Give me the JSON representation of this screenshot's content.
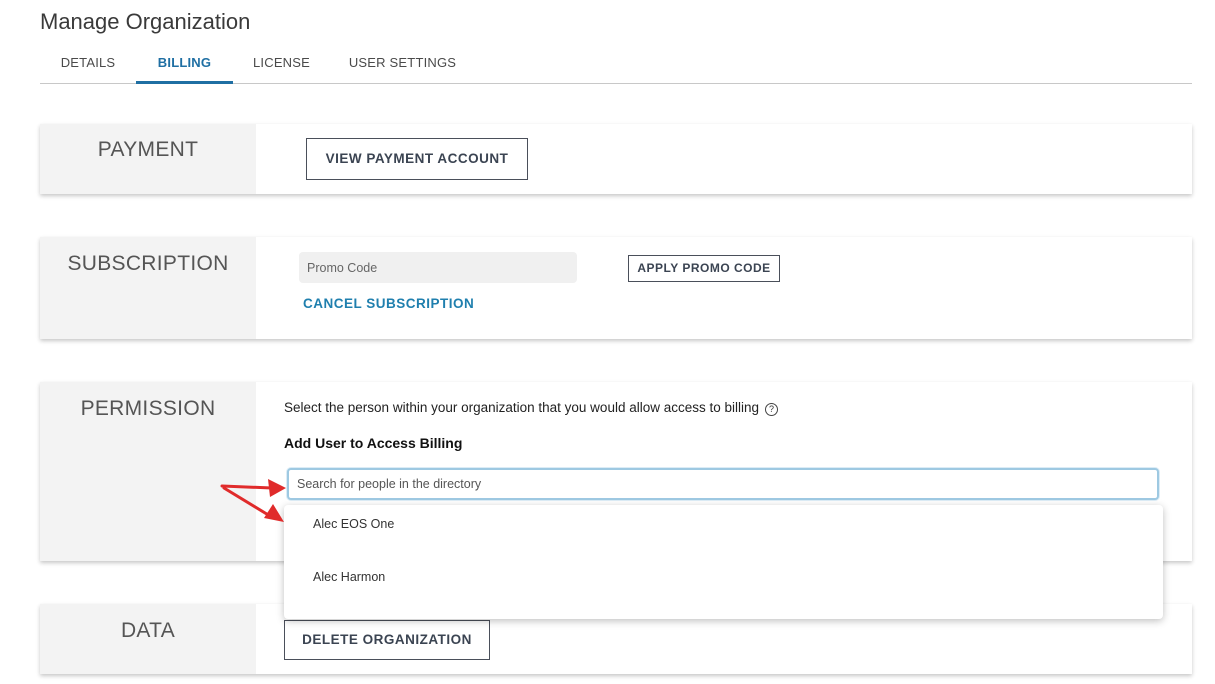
{
  "page": {
    "title": "Manage Organization"
  },
  "tabs": [
    {
      "label": "DETAILS",
      "active": false
    },
    {
      "label": "BILLING",
      "active": true
    },
    {
      "label": "LICENSE",
      "active": false
    },
    {
      "label": "USER SETTINGS",
      "active": false
    }
  ],
  "payment": {
    "label": "PAYMENT",
    "view_button": "VIEW PAYMENT ACCOUNT"
  },
  "subscription": {
    "label": "SUBSCRIPTION",
    "promo_placeholder": "Promo Code",
    "apply_button": "APPLY PROMO CODE",
    "cancel_link": "CANCEL SUBSCRIPTION"
  },
  "permission": {
    "label": "PERMISSION",
    "description": "Select the person within your organization that you would allow access to billing",
    "add_user_label": "Add User to Access Billing",
    "search_placeholder": "Search for people in the directory",
    "dropdown_items": [
      "Alec EOS One",
      "Alec Harmon"
    ]
  },
  "data_section": {
    "label": "DATA",
    "delete_button": "DELETE ORGANIZATION"
  },
  "colors": {
    "accent": "#1f6fa3",
    "link": "#1f7fae",
    "annotation_arrow": "#e02b2b"
  },
  "icons": {
    "help": "question-circle-icon"
  }
}
